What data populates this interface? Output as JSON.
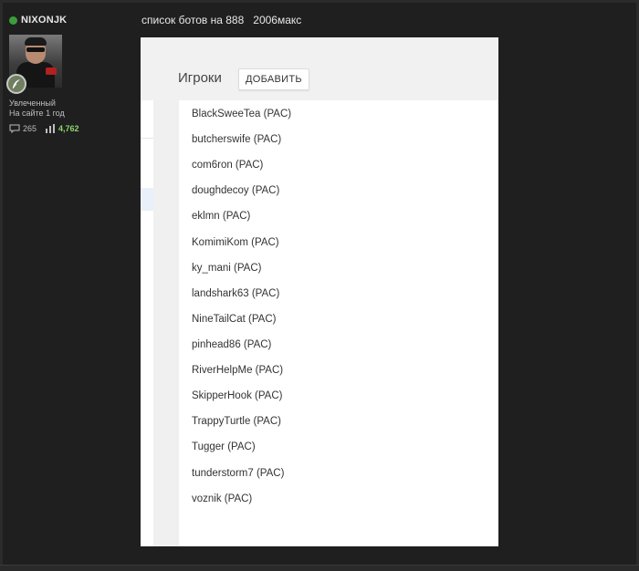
{
  "user": {
    "username": "NIXONJK",
    "status": "Увлеченный",
    "tenure": "На сайте 1 год",
    "posts_count": "265",
    "rating": "4,762"
  },
  "post": {
    "title": "список ботов на 888   2006макс"
  },
  "panel": {
    "section_title": "Игроки",
    "add_button_label": "ДОБАВИТЬ",
    "players": [
      "BlackSweeTea (PAC)",
      "butcherswife (PAC)",
      "com6ron (PAC)",
      "doughdecoy (PAC)",
      "eklmn (PAC)",
      "KomimiKom (PAC)",
      "ky_mani (PAC)",
      "landshark63 (PAC)",
      "NineTailCat (PAC)",
      "pinhead86 (PAC)",
      "RiverHelpMe (PAC)",
      "SkipperHook (PAC)",
      "TrappyTurtle (PAC)",
      "Tugger (PAC)",
      "tunderstorm7 (PAC)",
      "voznik (PAC)"
    ]
  },
  "colors": {
    "page_bg": "#1f1f20",
    "online": "#3a9f3a",
    "rating_green": "#8fd46a"
  },
  "icons": {
    "online": "online-status-icon",
    "badge": "feather-badge-icon",
    "comments": "comment-icon",
    "rating": "bar-chart-icon"
  }
}
